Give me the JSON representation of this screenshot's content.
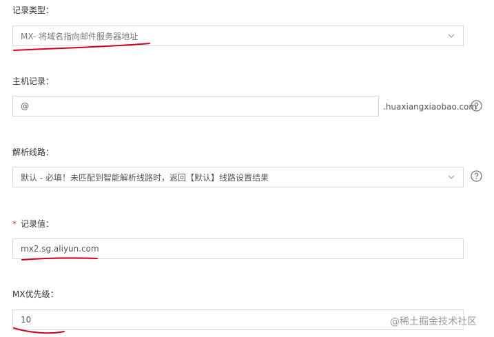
{
  "record_type": {
    "label": "记录类型：",
    "value": "MX- 将域名指向邮件服务器地址"
  },
  "host_record": {
    "label": "主机记录：",
    "value": "@",
    "suffix": ".huaxiangxiaobao.com"
  },
  "resolution_line": {
    "label": "解析线路：",
    "value": "默认 - 必填！未匹配到智能解析线路时，返回【默认】线路设置结果"
  },
  "record_value": {
    "required_mark": "*",
    "label": "记录值：",
    "value": "mx2.sg.aliyun.com"
  },
  "mx_priority": {
    "label": "MX优先级：",
    "value": "10"
  },
  "watermark": "@稀土掘金技术社区",
  "colors": {
    "annotation_red": "#d0021b",
    "required_red": "#d93026",
    "border": "#d7d8d9"
  }
}
